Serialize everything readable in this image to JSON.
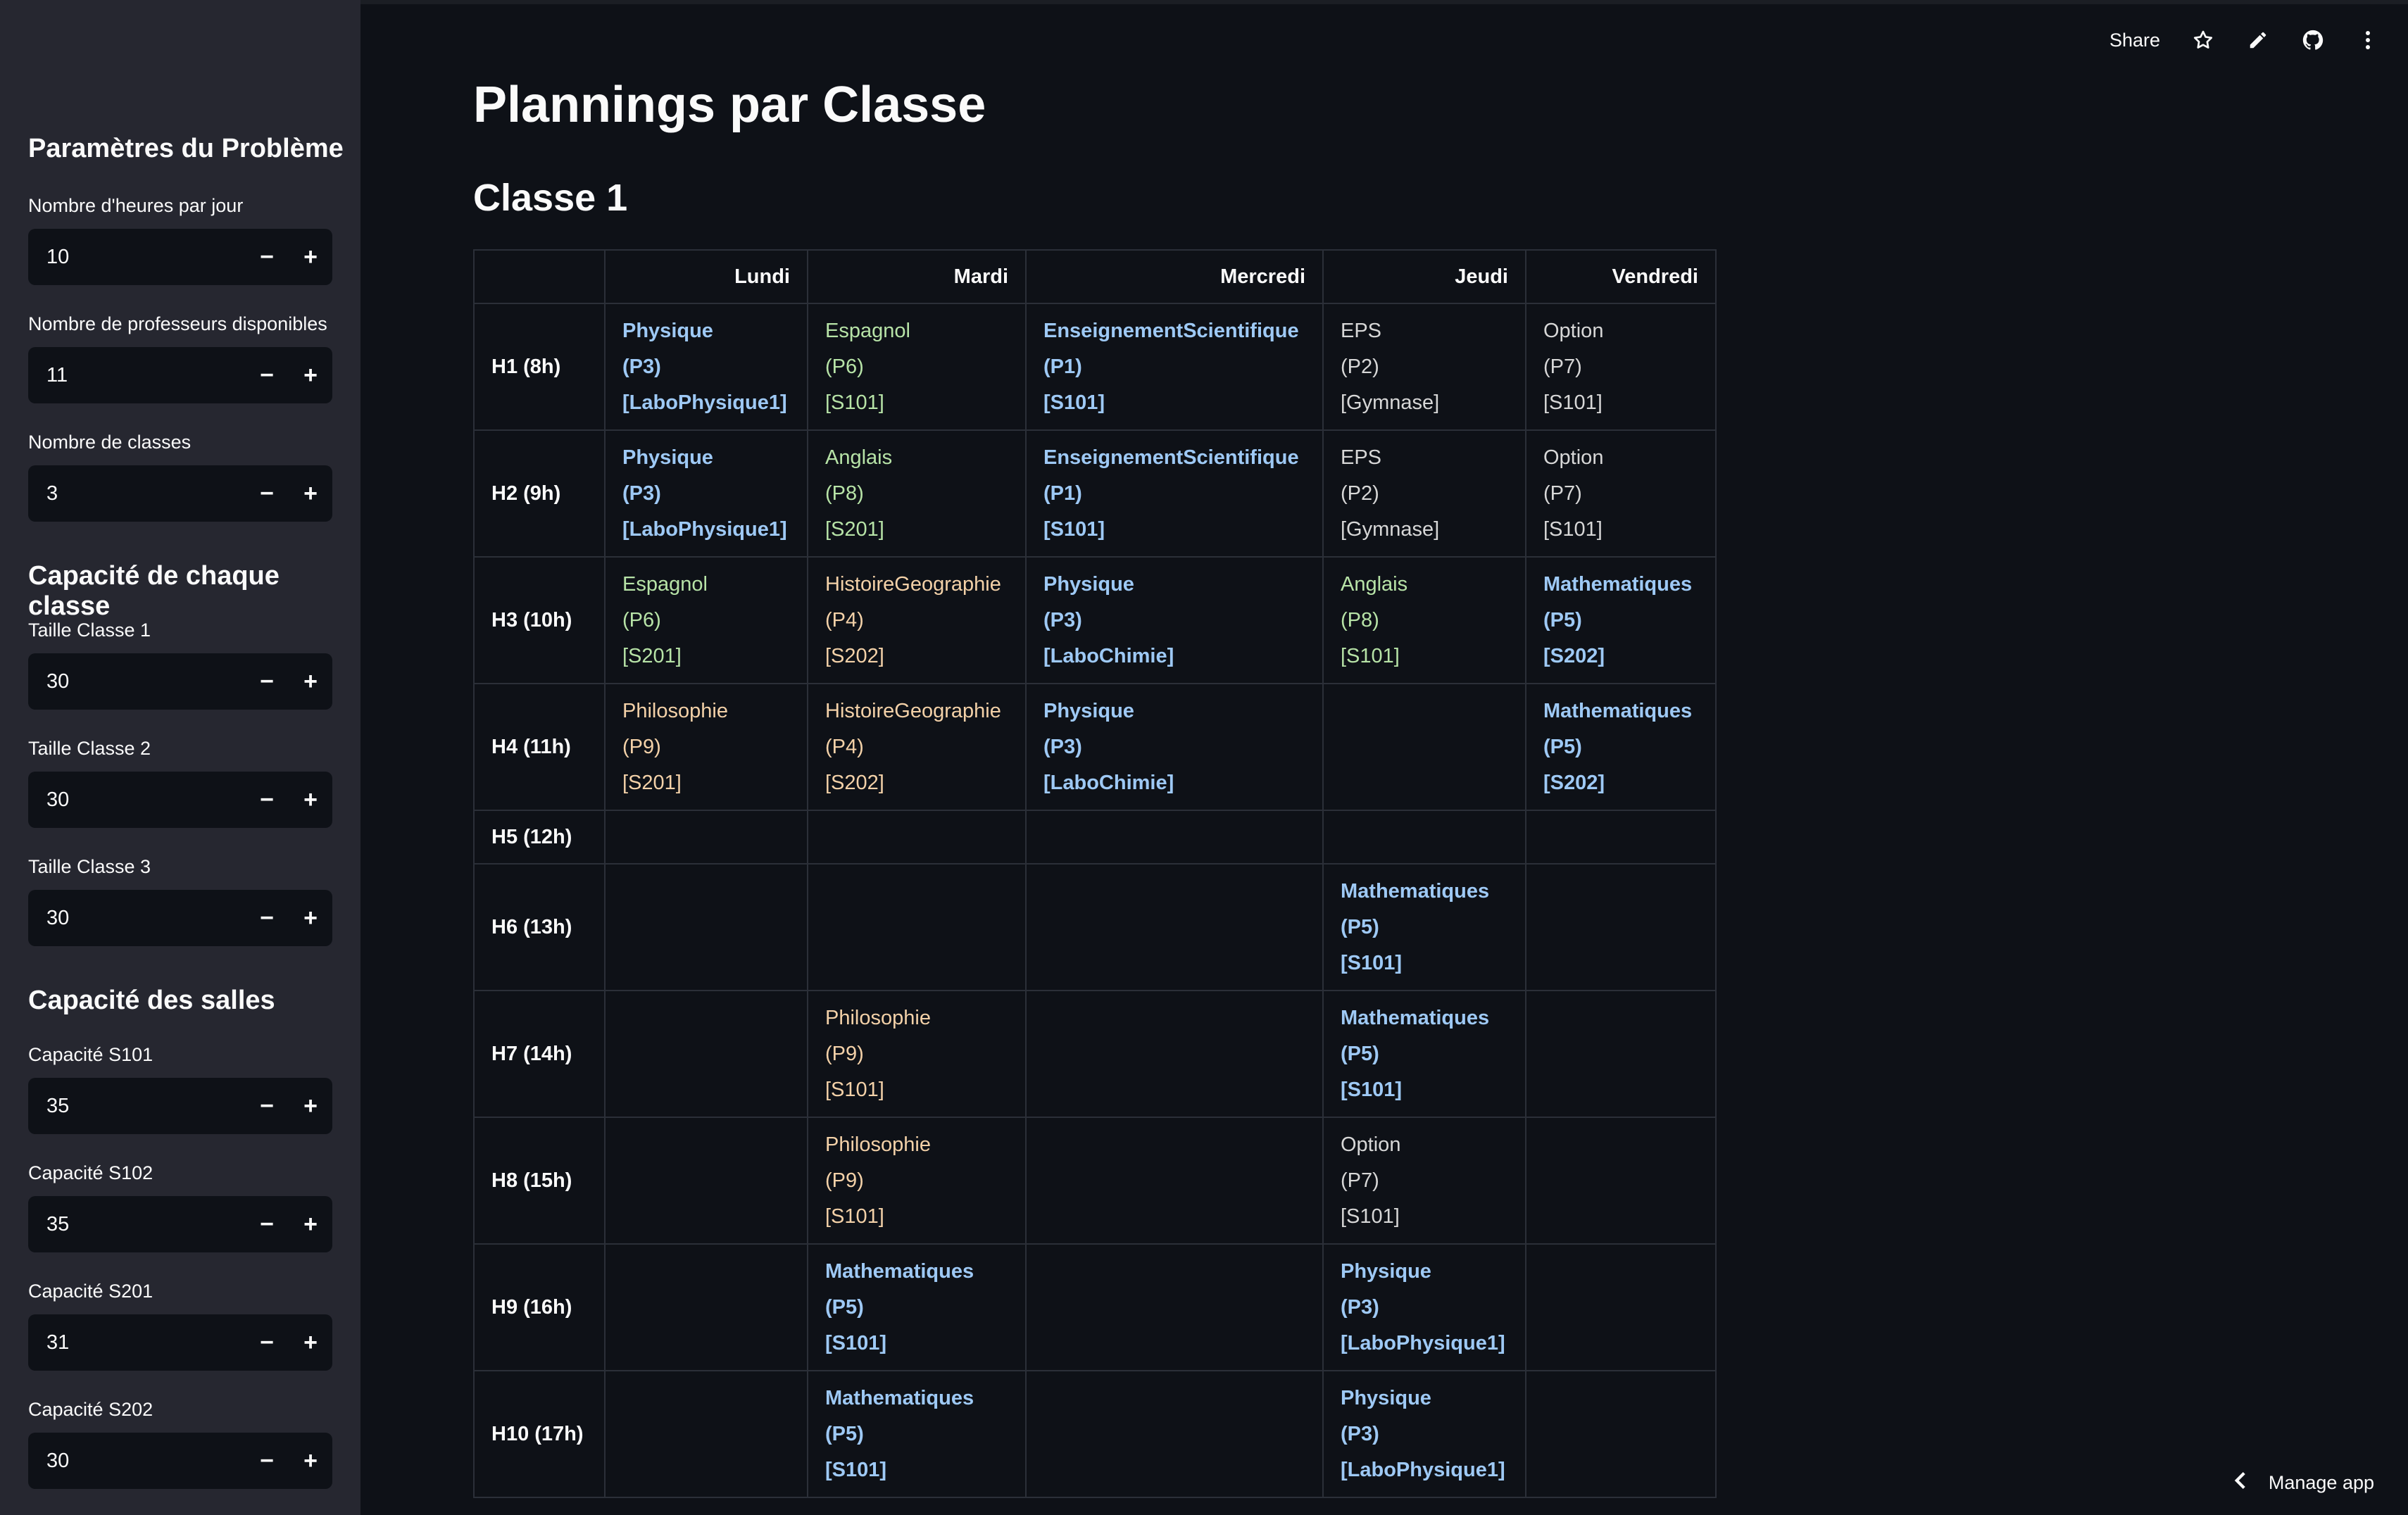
{
  "header": {
    "share_label": "Share",
    "icons": [
      "star-icon",
      "edit-icon",
      "github-icon",
      "more-icon"
    ]
  },
  "sidebar": {
    "problem_title": "Paramètres du Problème",
    "hours_label": "Nombre d'heures par jour",
    "hours_value": "10",
    "profs_label": "Nombre de professeurs disponibles",
    "profs_value": "11",
    "classes_label": "Nombre de classes",
    "classes_value": "3",
    "class_capacity_title": "Capacité de chaque classe",
    "class1_label": "Taille Classe 1",
    "class1_value": "30",
    "class2_label": "Taille Classe 2",
    "class2_value": "30",
    "class3_label": "Taille Classe 3",
    "class3_value": "30",
    "rooms_title": "Capacité des salles",
    "s101_label": "Capacité S101",
    "s101_value": "35",
    "s102_label": "Capacité S102",
    "s102_value": "35",
    "s201_label": "Capacité S201",
    "s201_value": "31",
    "s202_label": "Capacité S202",
    "s202_value": "30",
    "minus": "−",
    "plus": "+"
  },
  "main": {
    "title": "Plannings par Classe",
    "class_title": "Classe 1",
    "days": [
      "Lundi",
      "Mardi",
      "Mercredi",
      "Jeudi",
      "Vendredi"
    ],
    "rows": [
      {
        "hour": "H1 (8h)",
        "cells": [
          {
            "lines": [
              "Physique",
              "(P3)",
              "[LaboPhysique1]"
            ],
            "color": "blue"
          },
          {
            "lines": [
              "Espagnol",
              "(P6)",
              "[S101]"
            ],
            "color": "green"
          },
          {
            "lines": [
              "EnseignementScientifique",
              "(P1)",
              "[S101]"
            ],
            "color": "blue"
          },
          {
            "lines": [
              "EPS",
              "(P2)",
              "[Gymnase]"
            ],
            "color": "gray"
          },
          {
            "lines": [
              "Option",
              "(P7)",
              "[S101]"
            ],
            "color": "gray"
          }
        ]
      },
      {
        "hour": "H2 (9h)",
        "cells": [
          {
            "lines": [
              "Physique",
              "(P3)",
              "[LaboPhysique1]"
            ],
            "color": "blue"
          },
          {
            "lines": [
              "Anglais",
              "(P8)",
              "[S201]"
            ],
            "color": "green"
          },
          {
            "lines": [
              "EnseignementScientifique",
              "(P1)",
              "[S101]"
            ],
            "color": "blue"
          },
          {
            "lines": [
              "EPS",
              "(P2)",
              "[Gymnase]"
            ],
            "color": "gray"
          },
          {
            "lines": [
              "Option",
              "(P7)",
              "[S101]"
            ],
            "color": "gray"
          }
        ]
      },
      {
        "hour": "H3 (10h)",
        "cells": [
          {
            "lines": [
              "Espagnol",
              "(P6)",
              "[S201]"
            ],
            "color": "green"
          },
          {
            "lines": [
              "HistoireGeographie",
              "(P4)",
              "[S202]"
            ],
            "color": "orange"
          },
          {
            "lines": [
              "Physique",
              "(P3)",
              "[LaboChimie]"
            ],
            "color": "blue"
          },
          {
            "lines": [
              "Anglais",
              "(P8)",
              "[S101]"
            ],
            "color": "green"
          },
          {
            "lines": [
              "Mathematiques",
              "(P5)",
              "[S202]"
            ],
            "color": "blue"
          }
        ]
      },
      {
        "hour": "H4 (11h)",
        "cells": [
          {
            "lines": [
              "Philosophie",
              "(P9)",
              "[S201]"
            ],
            "color": "orange"
          },
          {
            "lines": [
              "HistoireGeographie",
              "(P4)",
              "[S202]"
            ],
            "color": "orange"
          },
          {
            "lines": [
              "Physique",
              "(P3)",
              "[LaboChimie]"
            ],
            "color": "blue"
          },
          {
            "lines": [],
            "color": ""
          },
          {
            "lines": [
              "Mathematiques",
              "(P5)",
              "[S202]"
            ],
            "color": "blue"
          }
        ]
      },
      {
        "hour": "H5 (12h)",
        "cells": [
          {
            "lines": [],
            "color": ""
          },
          {
            "lines": [],
            "color": ""
          },
          {
            "lines": [],
            "color": ""
          },
          {
            "lines": [],
            "color": ""
          },
          {
            "lines": [],
            "color": ""
          }
        ]
      },
      {
        "hour": "H6 (13h)",
        "cells": [
          {
            "lines": [],
            "color": ""
          },
          {
            "lines": [],
            "color": ""
          },
          {
            "lines": [],
            "color": ""
          },
          {
            "lines": [
              "Mathematiques",
              "(P5)",
              "[S101]"
            ],
            "color": "blue"
          },
          {
            "lines": [],
            "color": ""
          }
        ]
      },
      {
        "hour": "H7 (14h)",
        "cells": [
          {
            "lines": [],
            "color": ""
          },
          {
            "lines": [
              "Philosophie",
              "(P9)",
              "[S101]"
            ],
            "color": "orange"
          },
          {
            "lines": [],
            "color": ""
          },
          {
            "lines": [
              "Mathematiques",
              "(P5)",
              "[S101]"
            ],
            "color": "blue"
          },
          {
            "lines": [],
            "color": ""
          }
        ]
      },
      {
        "hour": "H8 (15h)",
        "cells": [
          {
            "lines": [],
            "color": ""
          },
          {
            "lines": [
              "Philosophie",
              "(P9)",
              "[S101]"
            ],
            "color": "orange"
          },
          {
            "lines": [],
            "color": ""
          },
          {
            "lines": [
              "Option",
              "(P7)",
              "[S101]"
            ],
            "color": "gray"
          },
          {
            "lines": [],
            "color": ""
          }
        ]
      },
      {
        "hour": "H9 (16h)",
        "cells": [
          {
            "lines": [],
            "color": ""
          },
          {
            "lines": [
              "Mathematiques",
              "(P5)",
              "[S101]"
            ],
            "color": "blue"
          },
          {
            "lines": [],
            "color": ""
          },
          {
            "lines": [
              "Physique",
              "(P3)",
              "[LaboPhysique1]"
            ],
            "color": "blue"
          },
          {
            "lines": [],
            "color": ""
          }
        ]
      },
      {
        "hour": "H10 (17h)",
        "cells": [
          {
            "lines": [],
            "color": ""
          },
          {
            "lines": [
              "Mathematiques",
              "(P5)",
              "[S101]"
            ],
            "color": "blue"
          },
          {
            "lines": [],
            "color": ""
          },
          {
            "lines": [
              "Physique",
              "(P3)",
              "[LaboPhysique1]"
            ],
            "color": "blue"
          },
          {
            "lines": [],
            "color": ""
          }
        ]
      }
    ]
  },
  "footer": {
    "manage_label": "Manage app"
  }
}
